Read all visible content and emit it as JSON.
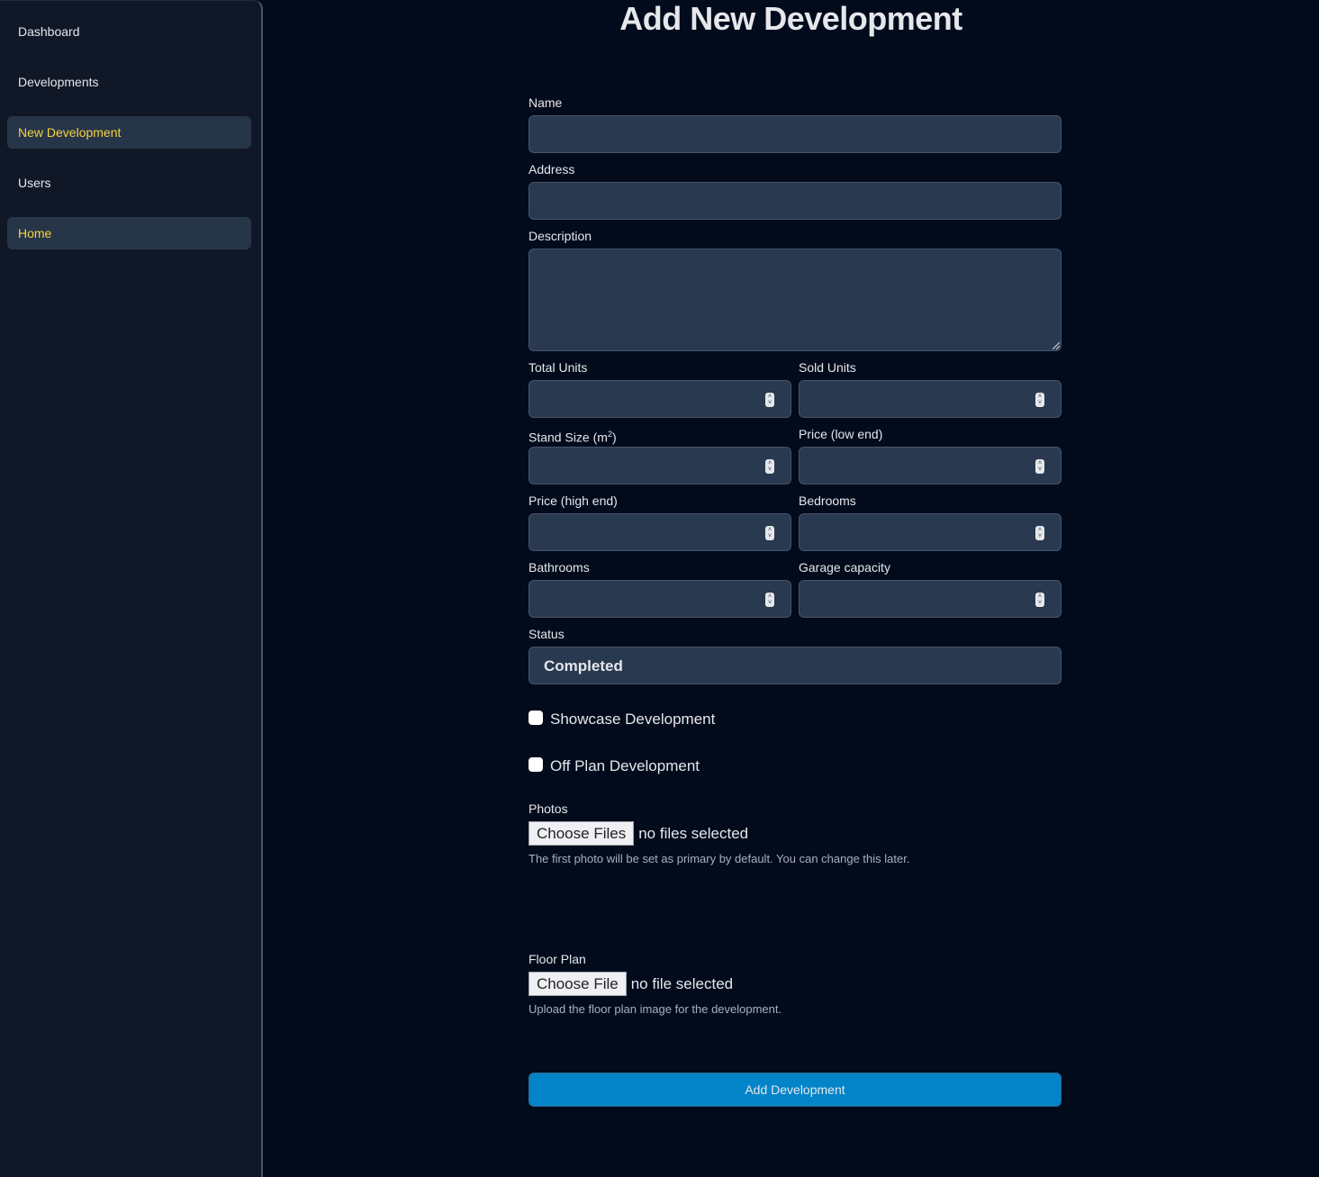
{
  "sidebar": {
    "items": [
      {
        "label": "Dashboard",
        "active": false
      },
      {
        "label": "Developments",
        "active": false
      },
      {
        "label": "New Development",
        "active": true
      },
      {
        "label": "Users",
        "active": false
      },
      {
        "label": "Home",
        "active": true
      }
    ]
  },
  "page": {
    "title": "Add New Development"
  },
  "form": {
    "name": {
      "label": "Name",
      "value": ""
    },
    "address": {
      "label": "Address",
      "value": ""
    },
    "description": {
      "label": "Description",
      "value": ""
    },
    "total_units": {
      "label": "Total Units",
      "value": ""
    },
    "sold_units": {
      "label": "Sold Units",
      "value": ""
    },
    "stand_size": {
      "label": "Stand Size (m",
      "label_sup": "2",
      "label_suffix": ")",
      "value": ""
    },
    "price_low": {
      "label": "Price (low end)",
      "value": ""
    },
    "price_high": {
      "label": "Price (high end)",
      "value": ""
    },
    "bedrooms": {
      "label": "Bedrooms",
      "value": ""
    },
    "bathrooms": {
      "label": "Bathrooms",
      "value": ""
    },
    "garage": {
      "label": "Garage capacity",
      "value": ""
    },
    "status": {
      "label": "Status",
      "selected": "Completed"
    },
    "showcase": {
      "label": "Showcase Development",
      "checked": false
    },
    "off_plan": {
      "label": "Off Plan Development",
      "checked": false
    },
    "photos": {
      "label": "Photos",
      "button": "Choose Files",
      "status": "no files selected",
      "help": "The first photo will be set as primary by default. You can change this later."
    },
    "floor_plan": {
      "label": "Floor Plan",
      "button": "Choose File",
      "status": "no file selected",
      "help": "Upload the floor plan image for the development."
    },
    "submit_label": "Add Development"
  }
}
